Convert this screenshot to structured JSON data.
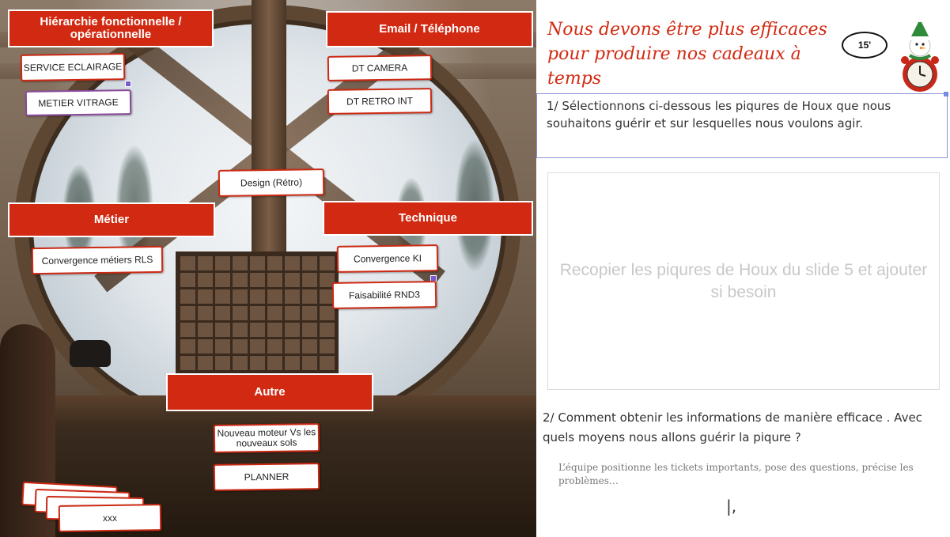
{
  "board": {
    "headers": {
      "hierarchy": "Hiérarchie fonctionnelle / opérationnelle",
      "email": "Email / Téléphone",
      "metier": "Métier",
      "technique": "Technique",
      "autre": "Autre"
    },
    "cards": {
      "service_eclairage": "SERVICE ECLAIRAGE",
      "metier_vitrage": "METIER VITRAGE",
      "dt_camera": "DT CAMERA",
      "dt_retro_int": "DT RETRO INT",
      "design_retro": "Design (Rétro)",
      "convergence_metiers": "Convergence métiers RLS",
      "convergence_ki": "Convergence KI",
      "faisabilite": "Faisabilité RND3",
      "nouveau_moteur": "Nouveau moteur Vs les nouveaux sols",
      "planner": "PLANNER",
      "xxx": "xxx"
    }
  },
  "panel": {
    "title": "Nous devons être plus efficaces pour produire nos cadeaux à temps",
    "timer": "15'",
    "question1": "1/ Sélectionnons ci-dessous les piqures de Houx que nous souhaitons guérir et sur lesquelles nous voulons agir.",
    "drop_placeholder": "Recopier les piqures de Houx du slide 5 et ajouter si besoin",
    "question2": "2/ Comment obtenir les informations de manière efficace . Avec quels moyens nous allons guérir la piqure ?",
    "answer_hint": "L’équipe positionne les tickets importants, pose des questions, précise les problèmes…",
    "cursor_text": "|,"
  }
}
